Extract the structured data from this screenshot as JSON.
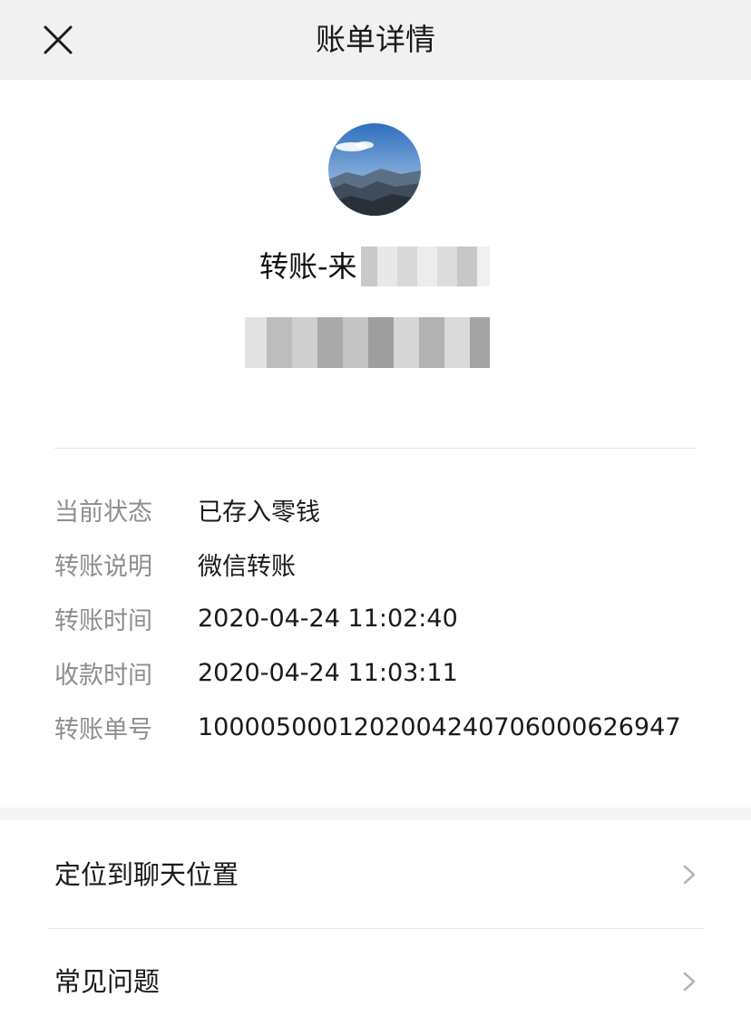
{
  "header": {
    "title": "账单详情",
    "close_icon": "close-icon"
  },
  "payer": {
    "avatar_icon": "landscape-avatar",
    "from_label": "转账-来"
  },
  "details": [
    {
      "label": "当前状态",
      "value": "已存入零钱"
    },
    {
      "label": "转账说明",
      "value": "微信转账"
    },
    {
      "label": "转账时间",
      "value": "2020-04-24 11:02:40"
    },
    {
      "label": "收款时间",
      "value": "2020-04-24 11:03:11"
    },
    {
      "label": "转账单号",
      "value": "1000050001202004240706000626947"
    }
  ],
  "menu": {
    "locate_label": "定位到聊天位置",
    "faq_label": "常见问题",
    "chevron_icon": "chevron-right-icon"
  },
  "colors": {
    "header_bg": "#f1f1f1",
    "label_gray": "#8e8e8e",
    "text": "#1a1a1a"
  }
}
